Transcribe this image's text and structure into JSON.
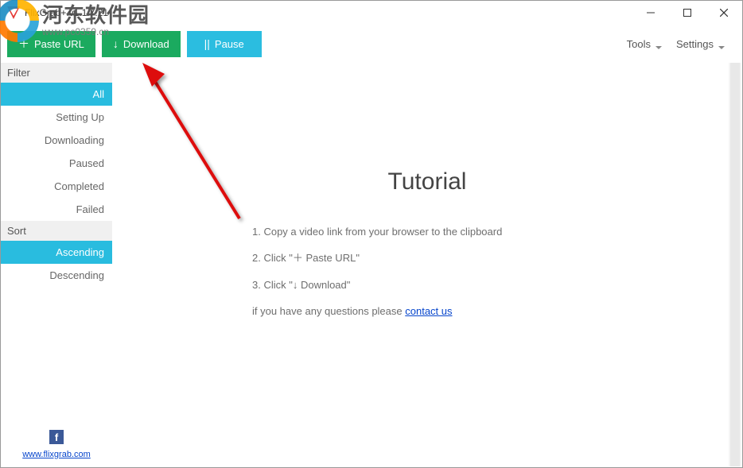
{
  "titlebar": {
    "title": "FlixGrab+ v1.1.7.21"
  },
  "toolbar": {
    "paste": {
      "symbol": "＋",
      "label": "Paste URL"
    },
    "download": {
      "symbol": "↓",
      "label": "Download"
    },
    "pause": {
      "symbol": "||",
      "label": "Pause"
    }
  },
  "menu": {
    "tools": "Tools",
    "settings": "Settings"
  },
  "sidebar": {
    "filter_header": "Filter",
    "filter_items": [
      "All",
      "Setting Up",
      "Downloading",
      "Paused",
      "Completed",
      "Failed"
    ],
    "filter_active": 0,
    "sort_header": "Sort",
    "sort_items": [
      "Ascending",
      "Descending"
    ],
    "sort_active": 0,
    "footer_link": "www.flixgrab.com"
  },
  "tutorial": {
    "title": "Tutorial",
    "step1": "1. Copy a video link from your browser to the clipboard",
    "step2": "2. Click \"＋ Paste URL\"",
    "step3": "3. Click \"↓ Download\"",
    "questions_prefix": "if you have any questions please ",
    "contact": "contact us"
  },
  "watermark": {
    "text": "河东软件园",
    "url": "www.pc0359.cn"
  }
}
